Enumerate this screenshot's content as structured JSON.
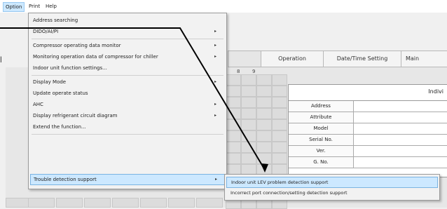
{
  "menubar": {
    "items": [
      {
        "label": "Option",
        "active": true
      },
      {
        "label": "Print",
        "active": false
      },
      {
        "label": "Help",
        "active": false
      }
    ]
  },
  "background": {
    "tabs": [
      "Operation",
      "Date/Time Setting",
      "Main"
    ],
    "col_numbers": [
      "8",
      "9"
    ],
    "panel_header": "Indivi",
    "fields": [
      "Address",
      "Attribute",
      "Model",
      "Serial No.",
      "Ver.",
      "G. No."
    ]
  },
  "option_menu": {
    "items": [
      {
        "label": "Address searching",
        "submenu": false
      },
      {
        "label": "DIDO/AI/PI",
        "submenu": true
      },
      {
        "label": "Compressor operating data monitor",
        "submenu": true
      },
      {
        "label": "Monitoring operation data of compressor for chiller",
        "submenu": true
      },
      {
        "label": "Indoor unit function settings...",
        "submenu": false
      },
      {
        "label": "Display Mode",
        "submenu": true
      },
      {
        "label": "Update operate status",
        "submenu": false
      },
      {
        "label": "AHC",
        "submenu": true
      },
      {
        "label": "Display refrigerant circuit diagram",
        "submenu": true
      },
      {
        "label": "Extend the function...",
        "submenu": false
      },
      {
        "label": "Trouble detection support",
        "submenu": true,
        "highlighted": true
      }
    ]
  },
  "trouble_submenu": {
    "items": [
      {
        "label": "Indoor unit LEV problem detection support",
        "highlighted": true
      },
      {
        "label": "Incorrect port connection/setting detection support",
        "highlighted": false
      }
    ]
  },
  "icons": {
    "submenu_arrow": "▸"
  }
}
